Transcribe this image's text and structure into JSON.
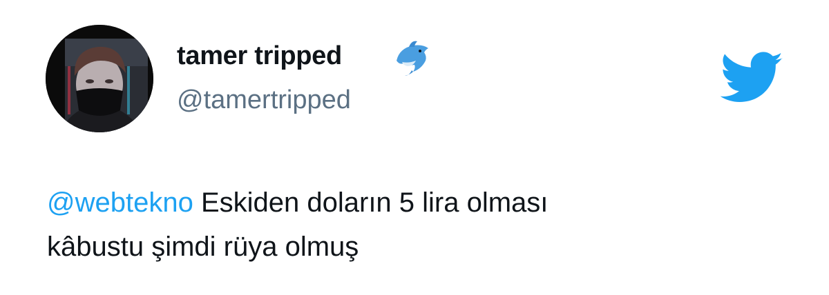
{
  "author": {
    "display_name": "tamer tripped",
    "handle": "@tamertripped",
    "badge_icon": "dolphin-icon"
  },
  "brand": {
    "icon": "twitter-bird-icon",
    "color": "#1DA1F2"
  },
  "tweet": {
    "mention": "@webtekno",
    "text_line1": " Eskiden doların 5 lira olması",
    "text_line2": "kâbustu şimdi rüya olmuş"
  }
}
